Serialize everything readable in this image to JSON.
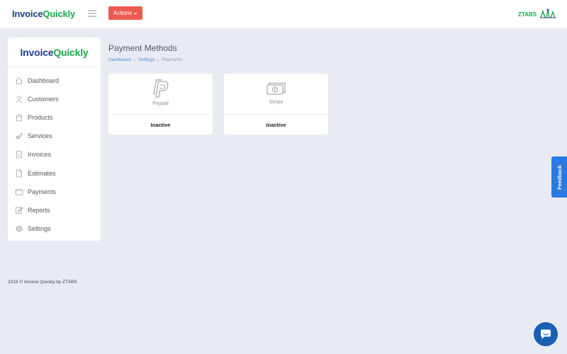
{
  "header": {
    "brand_part1": "Invoice",
    "brand_part2": "Quickly",
    "actions_label": "Actions",
    "partner": "ZTABS"
  },
  "sidebar": {
    "logo_part1": "Invoice",
    "logo_part2": "Quickly",
    "items": [
      {
        "label": "Dashboard",
        "icon": "home-icon"
      },
      {
        "label": "Customers",
        "icon": "user-icon"
      },
      {
        "label": "Products",
        "icon": "shopping-bag-icon"
      },
      {
        "label": "Services",
        "icon": "rocket-icon"
      },
      {
        "label": "Invoices",
        "icon": "document-icon"
      },
      {
        "label": "Estimates",
        "icon": "file-icon"
      },
      {
        "label": "Payments",
        "icon": "wallet-icon"
      },
      {
        "label": "Reports",
        "icon": "edit-icon"
      },
      {
        "label": "Settings",
        "icon": "gear-icon"
      }
    ]
  },
  "main": {
    "title": "Payment Methods",
    "breadcrumb": [
      "Dashboard",
      "Settings",
      "Payments"
    ],
    "cards": [
      {
        "name": "Paypal",
        "status": "Inactive",
        "icon": "paypal-icon"
      },
      {
        "name": "Stripe",
        "status": "Inactive",
        "icon": "cash-icon"
      }
    ]
  },
  "footer": {
    "text": "2019 © Invoice Quickly by ZTABS."
  },
  "feedback_label": "Feedback",
  "colors": {
    "brand_blue": "#1b3f8f",
    "brand_green": "#1ea64a",
    "actions_red": "#ec5a4f",
    "link_blue": "#4a8fd6",
    "feedback_blue": "#2a7ae4",
    "chat_blue": "#1a5fb4",
    "background": "#e9ebf3"
  }
}
